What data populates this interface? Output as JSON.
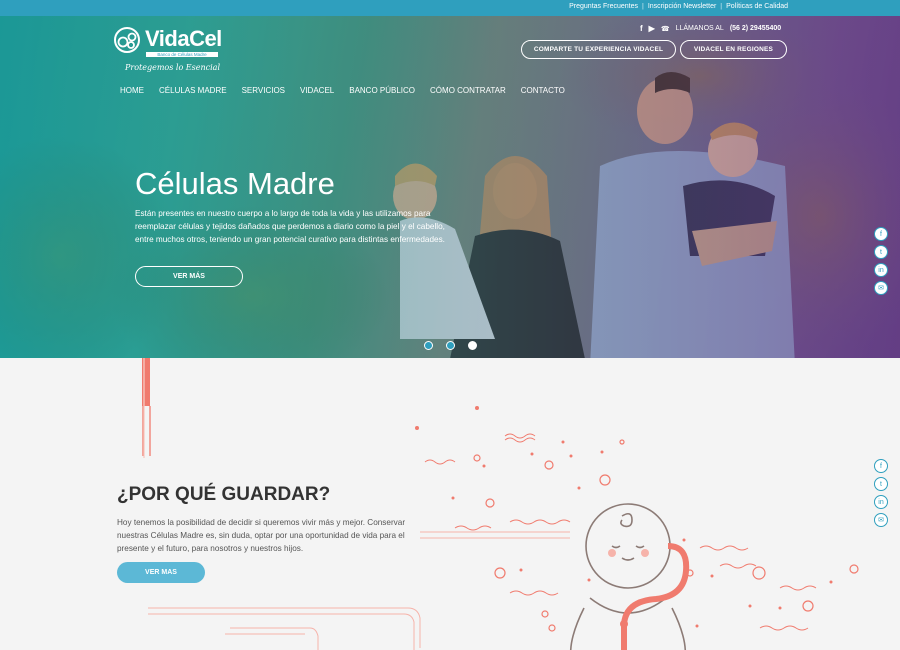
{
  "topbar": {
    "links": [
      "Preguntas Frecuentes",
      "Inscripción Newsletter",
      "Políticas de Calidad"
    ]
  },
  "brand": {
    "name": "VidaCel",
    "subtitle": "Banco de Células Madre",
    "tagline": "Protegemos lo Esencial"
  },
  "contact": {
    "prefix": "LLÁMANOS AL",
    "phone": "(56 2) 29455400"
  },
  "cta": {
    "share": "COMPARTE TU EXPERIENCIA VIDACEL",
    "regions": "VIDACEL EN REGIONES"
  },
  "nav": [
    "HOME",
    "CÉLULAS MADRE",
    "SERVICIOS",
    "VIDACEL",
    "BANCO PÚBLICO",
    "CÓMO CONTRATAR",
    "CONTACTO"
  ],
  "hero": {
    "title": "Células Madre",
    "text": "Están presentes en nuestro cuerpo a lo largo de toda la vida y las utilizamos para reemplazar células y tejidos dañados que perdemos a diario como la piel y el cabello, entre muchos otros, teniendo un gran potencial curativo para distintas enfermedades.",
    "button": "VER MÁS",
    "slides": 3,
    "active_slide": 3
  },
  "why": {
    "title": "¿POR QUÉ GUARDAR?",
    "text": "Hoy tenemos la posibilidad de decidir si queremos vivir más y mejor. Conservar nuestras Células Madre es, sin duda, optar por una oportunidad de vida para el presente y el futuro, para nosotros y nuestros hijos.",
    "button": "VER MAS"
  },
  "social_icons": [
    "facebook-icon",
    "twitter-icon",
    "linkedin-icon",
    "mail-icon"
  ],
  "colors": {
    "accent": "#2f9fbe",
    "button_fill": "#5cb8d6",
    "coral": "#f07b6e"
  }
}
